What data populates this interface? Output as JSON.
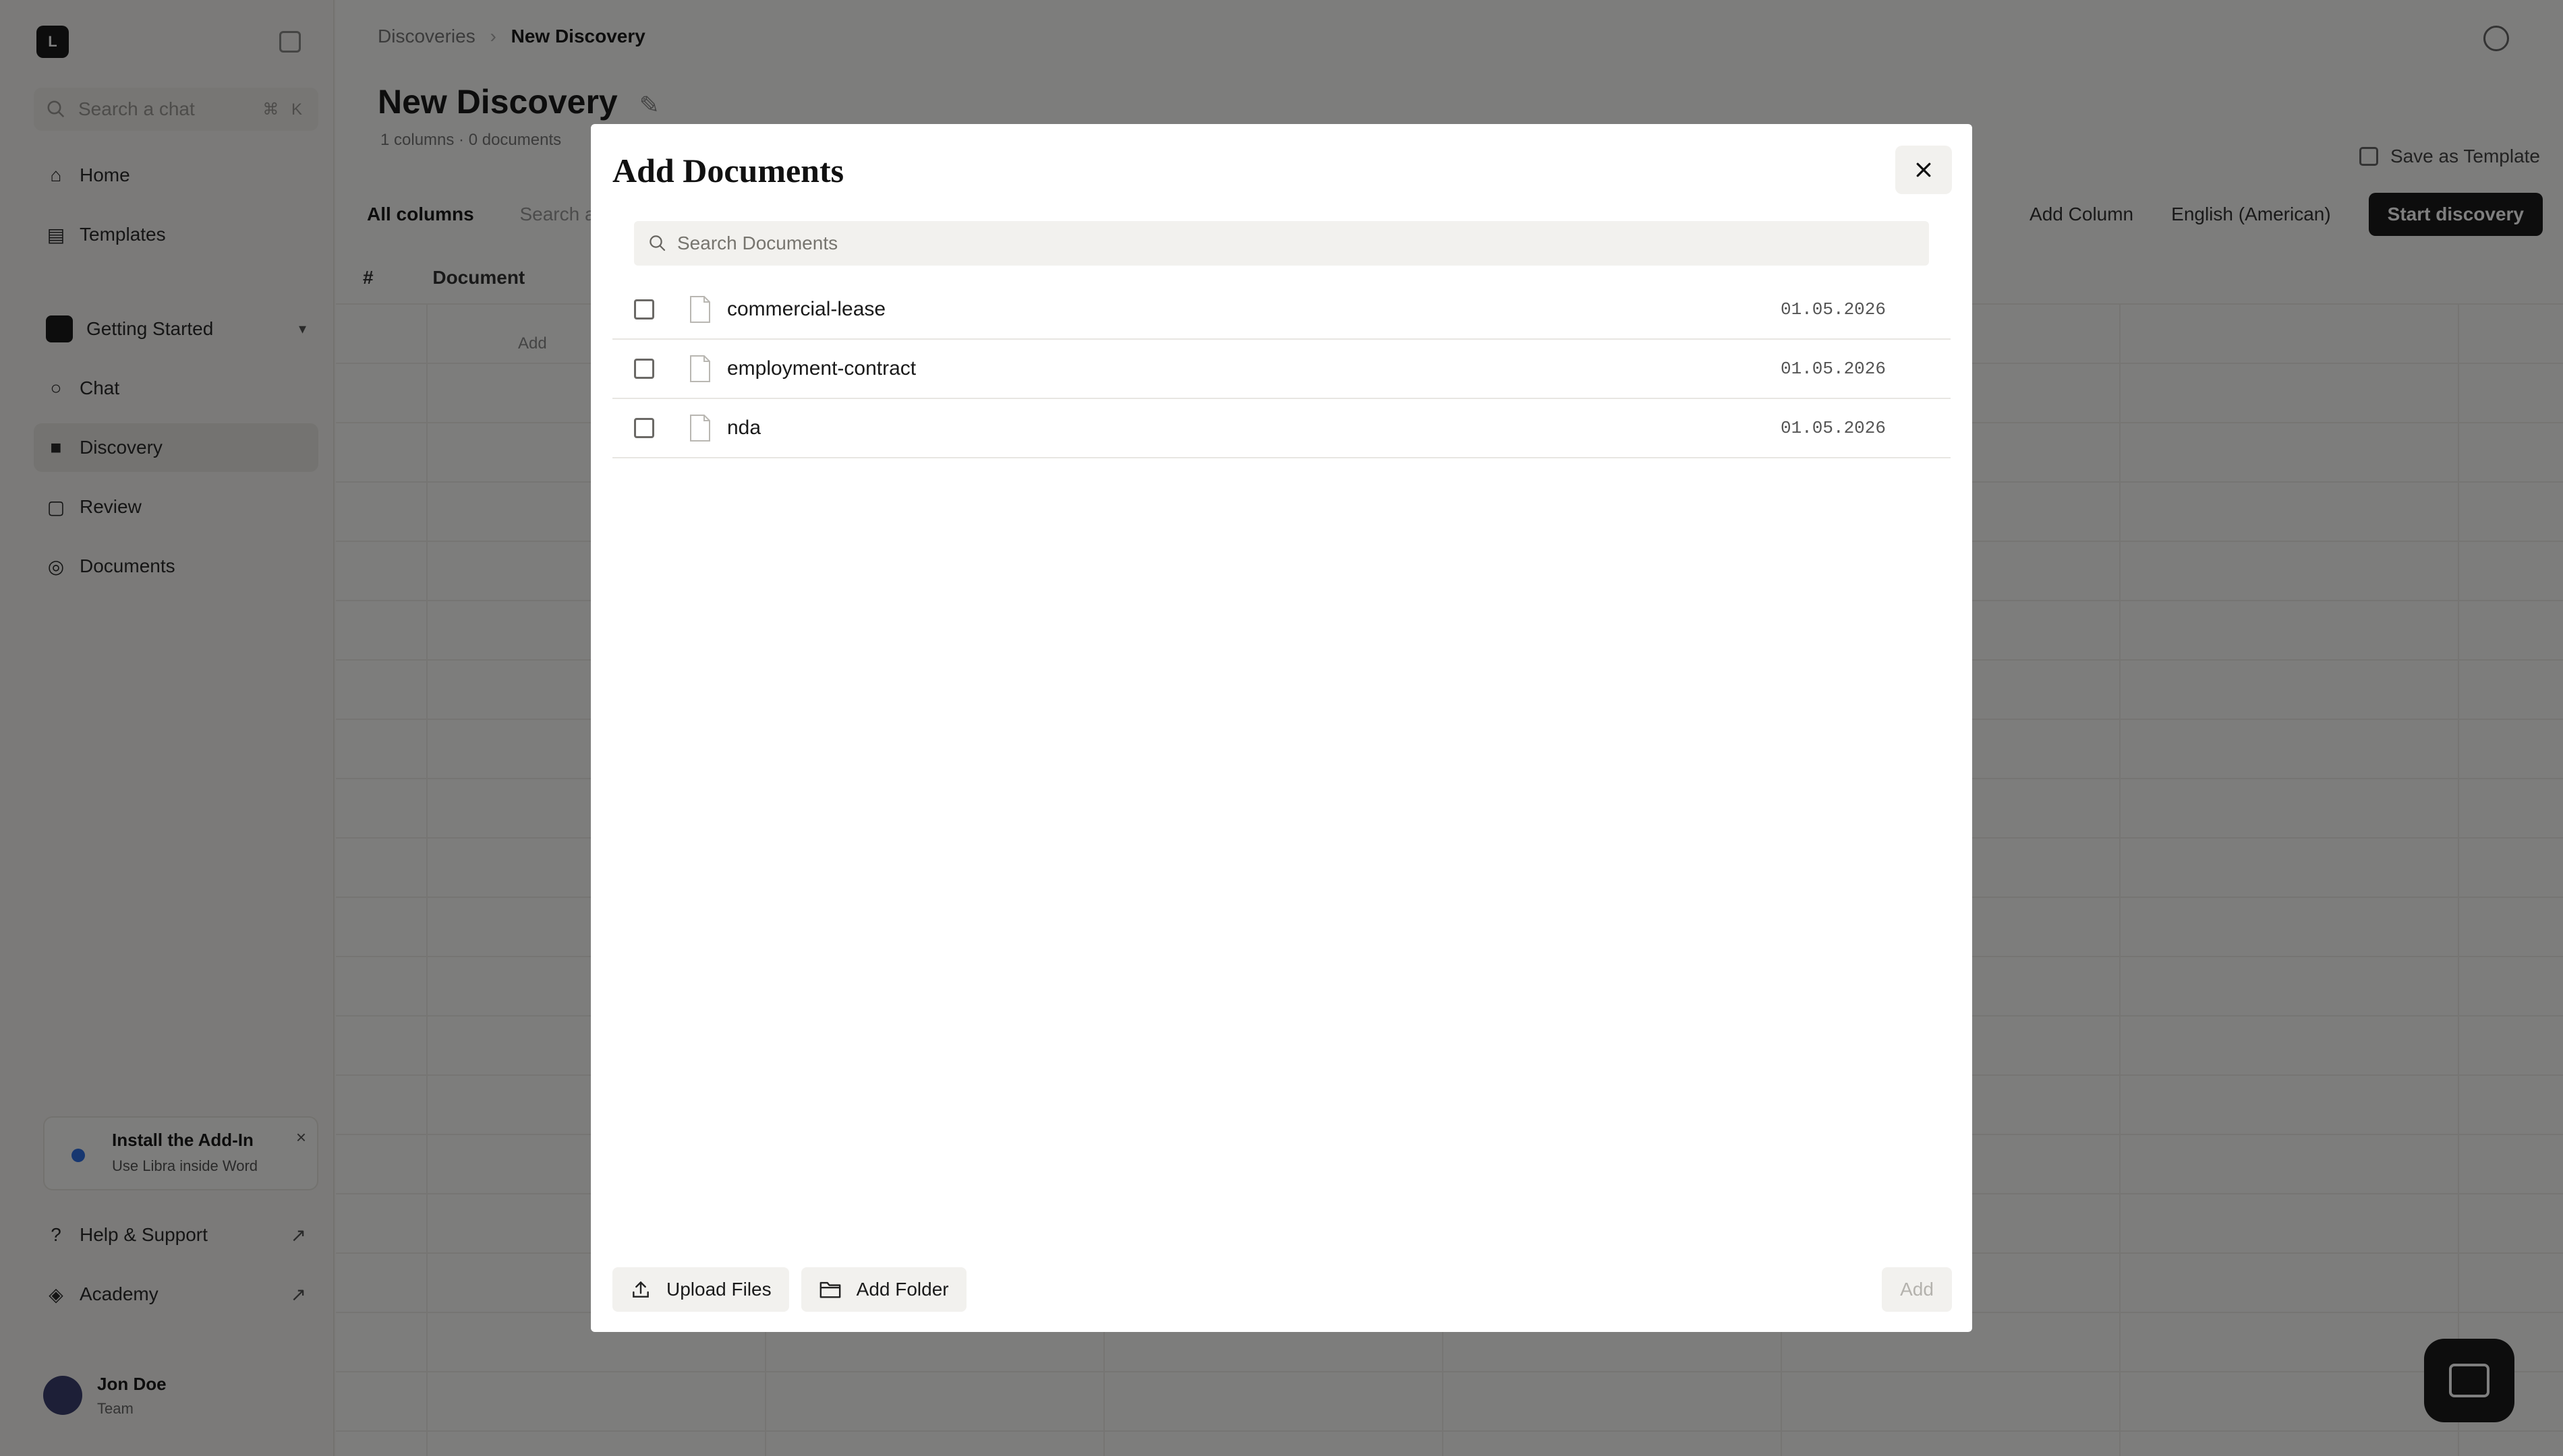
{
  "sidebar": {
    "logo": "L",
    "search_placeholder": "Search a chat",
    "search_shortcut": "⌘ K",
    "nav": [
      {
        "label": "Home"
      },
      {
        "label": "Templates"
      }
    ],
    "group": {
      "label": "Getting Started"
    },
    "group_items": [
      {
        "label": "Chat"
      },
      {
        "label": "Discovery"
      },
      {
        "label": "Review"
      },
      {
        "label": "Documents"
      }
    ],
    "promo": {
      "title": "Install the Add-In",
      "subtitle": "Use Libra inside Word"
    },
    "bottom_links": [
      {
        "label": "Help & Support"
      },
      {
        "label": "Academy"
      }
    ],
    "user": {
      "name": "Jon Doe",
      "team": "Team"
    }
  },
  "main": {
    "breadcrumb": {
      "parent": "Discoveries",
      "separator": "›",
      "current": "New Discovery"
    },
    "title": "New Discovery",
    "subtitle": "1 columns · 0 documents",
    "save_template": "Save as Template",
    "toolbar": {
      "all_columns": "All columns",
      "search": "Search a",
      "add_column": "Add Column",
      "language": "English (American)",
      "start": "Start discovery"
    },
    "columns": {
      "num": "#",
      "document": "Document"
    },
    "add_row": "Add"
  },
  "modal": {
    "title": "Add Documents",
    "search_placeholder": "Search Documents",
    "documents": [
      {
        "name": "commercial-lease",
        "date": "01.05.2026"
      },
      {
        "name": "employment-contract",
        "date": "01.05.2026"
      },
      {
        "name": "nda",
        "date": "01.05.2026"
      }
    ],
    "upload_label": "Upload Files",
    "add_folder_label": "Add Folder",
    "add_label": "Add"
  }
}
